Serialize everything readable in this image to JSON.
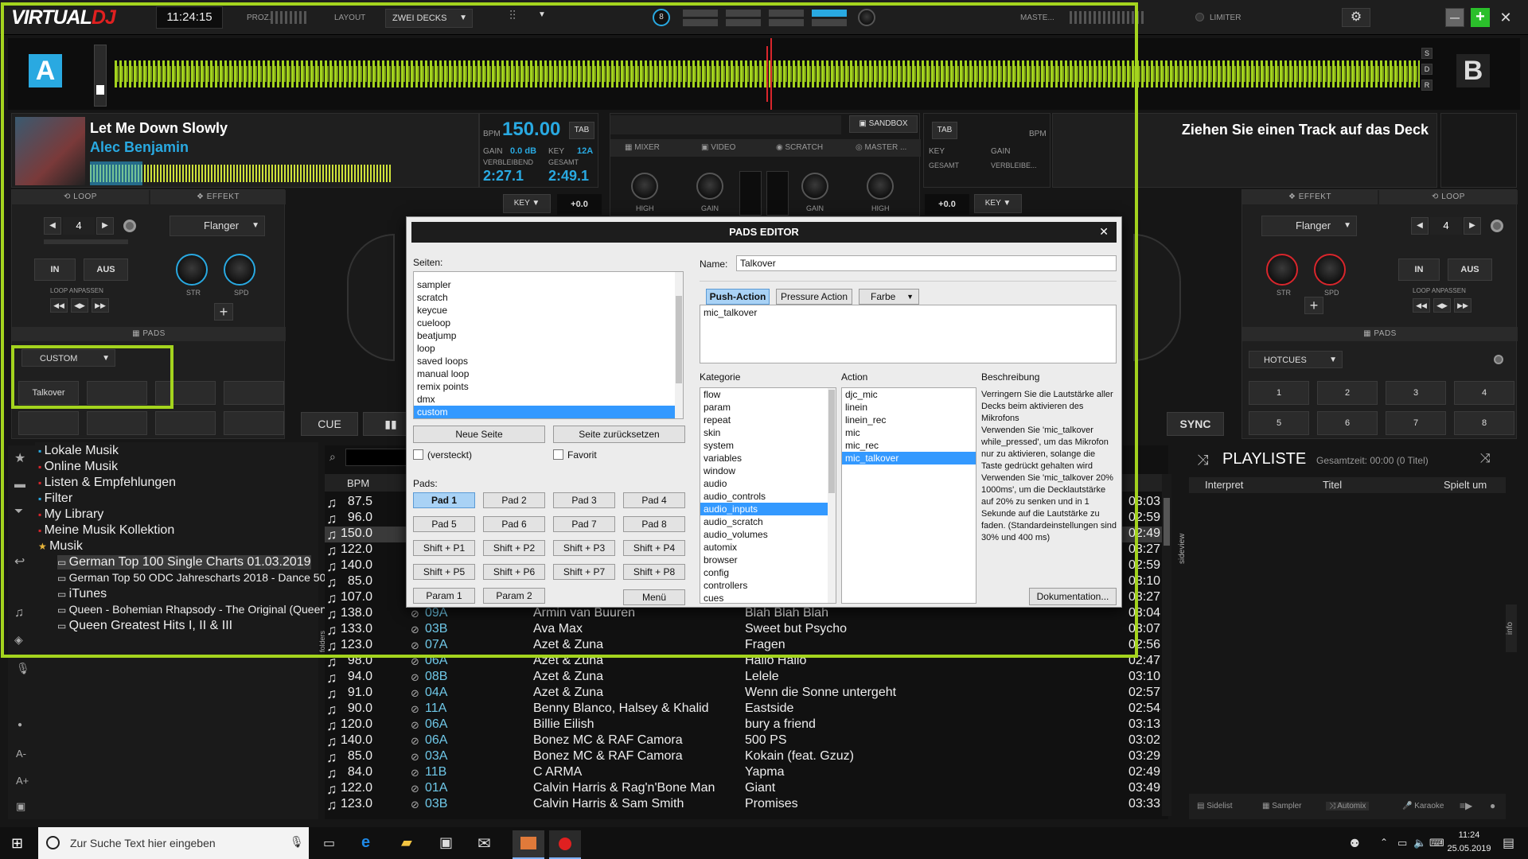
{
  "topbar": {
    "logo_virtual": "VIRTUAL",
    "logo_dj": "DJ",
    "clock": "11:24:15",
    "proz": "PROZ.",
    "layout_label": "LAYOUT",
    "layout_value": "ZWEI DECKS",
    "counter": "8",
    "master_label": "MASTE...",
    "limiter_label": "LIMITER"
  },
  "decks": {
    "a_letter": "A",
    "b_letter": "B",
    "side_s": "S",
    "side_d": "D",
    "side_r": "R"
  },
  "deckA": {
    "title": "Let Me Down Slowly",
    "artist": "Alec Benjamin",
    "bpm_label": "BPM",
    "bpm": "150.00",
    "tab": "TAB",
    "gain_label": "GAIN",
    "gain": "0.0 dB",
    "key_label": "KEY",
    "key": "12A",
    "remain_label": "VERBLEIBEND",
    "remain": "2:27.1",
    "total_label": "GESAMT",
    "total": "2:49.1",
    "key_btn": "KEY",
    "pitch": "+0.0",
    "loop_head": "LOOP",
    "effekt_head": "EFFEKT",
    "loop_val": "4",
    "effect": "Flanger",
    "in": "IN",
    "aus": "AUS",
    "str": "STR",
    "spd": "SPD",
    "loop_anpassen": "LOOP ANPASSEN",
    "pads_head": "PADS",
    "pad_mode": "CUSTOM",
    "pad1": "Talkover",
    "cue": "CUE"
  },
  "deckB": {
    "drop_text": "Ziehen Sie einen Track auf das Deck",
    "tab": "TAB",
    "bpm_label": "BPM",
    "key_label": "KEY",
    "gain_label": "GAIN",
    "total_label": "GESAMT",
    "remain_label": "VERBLEIBE...",
    "key_btn": "KEY",
    "pitch": "+0.0",
    "effekt_head": "EFFEKT",
    "loop_head": "LOOP",
    "effect": "Flanger",
    "loop_val": "4",
    "in": "IN",
    "aus": "AUS",
    "str": "STR",
    "spd": "SPD",
    "loop_anpassen": "LOOP ANPASSEN",
    "pads_head": "PADS",
    "pad_mode": "HOTCUES",
    "sync": "SYNC",
    "pads": [
      "1",
      "2",
      "3",
      "4",
      "5",
      "6",
      "7",
      "8"
    ]
  },
  "mixer": {
    "sandbox": "SANDBOX",
    "tab_mixer": "MIXER",
    "tab_video": "VIDEO",
    "tab_scratch": "SCRATCH",
    "tab_master": "MASTER ...",
    "high": "HIGH",
    "gain": "GAIN"
  },
  "browser": {
    "tree": [
      "Lokale Musik",
      "Online Musik",
      "Listen & Empfehlungen",
      "Filter",
      "My Library",
      "Meine Musik Kollektion",
      "Musik",
      "German Top 100 Single Charts 01.03.2019",
      "German Top 50 ODC Jahrescharts 2018 - Dance 50",
      "iTunes",
      "Queen - Bohemian Rhapsody - The Original (Queen -",
      "Queen Greatest Hits I, II & III"
    ],
    "folders_label": "folders",
    "col_bpm": "BPM",
    "rows": [
      {
        "bpm": "87.5",
        "key": "",
        "artist": "",
        "title": "",
        "time": "03:03"
      },
      {
        "bpm": "96.0",
        "key": "",
        "artist": "",
        "title": "",
        "time": "02:59"
      },
      {
        "bpm": "150.0",
        "key": "",
        "artist": "",
        "title": "",
        "time": "02:49"
      },
      {
        "bpm": "122.0",
        "key": "",
        "artist": "",
        "title": "",
        "time": "03:27"
      },
      {
        "bpm": "140.0",
        "key": "",
        "artist": "",
        "title": "",
        "time": "02:59"
      },
      {
        "bpm": "85.0",
        "key": "",
        "artist": "",
        "title": "",
        "time": "03:10"
      },
      {
        "bpm": "107.0",
        "key": "",
        "artist": "",
        "title": "",
        "time": "03:27"
      },
      {
        "bpm": "138.0",
        "key": "09A",
        "artist": "Armin van Buuren",
        "title": "Blah Blah Blah",
        "time": "03:04"
      },
      {
        "bpm": "133.0",
        "key": "03B",
        "artist": "Ava Max",
        "title": "Sweet but Psycho",
        "time": "03:07"
      },
      {
        "bpm": "123.0",
        "key": "07A",
        "artist": "Azet & Zuna",
        "title": "Fragen",
        "time": "02:56"
      },
      {
        "bpm": "98.0",
        "key": "06A",
        "artist": "Azet & Zuna",
        "title": "Hallo Hallo",
        "time": "02:47"
      },
      {
        "bpm": "94.0",
        "key": "08B",
        "artist": "Azet & Zuna",
        "title": "Lelele",
        "time": "03:10"
      },
      {
        "bpm": "91.0",
        "key": "04A",
        "artist": "Azet & Zuna",
        "title": "Wenn die Sonne untergeht",
        "time": "02:57"
      },
      {
        "bpm": "90.0",
        "key": "11A",
        "artist": "Benny Blanco, Halsey & Khalid",
        "title": "Eastside",
        "time": "02:54"
      },
      {
        "bpm": "120.0",
        "key": "06A",
        "artist": "Billie Eilish",
        "title": "bury a friend",
        "time": "03:13"
      },
      {
        "bpm": "140.0",
        "key": "06A",
        "artist": "Bonez MC & RAF Camora",
        "title": "500 PS",
        "time": "03:02"
      },
      {
        "bpm": "85.0",
        "key": "03A",
        "artist": "Bonez MC & RAF Camora",
        "title": "Kokain (feat. Gzuz)",
        "time": "03:29"
      },
      {
        "bpm": "84.0",
        "key": "11B",
        "artist": "C ARMA",
        "title": "Yapma",
        "time": "02:49"
      },
      {
        "bpm": "122.0",
        "key": "01A",
        "artist": "Calvin Harris & Rag'n'Bone Man",
        "title": "Giant",
        "time": "03:49"
      },
      {
        "bpm": "123.0",
        "key": "03B",
        "artist": "Calvin Harris & Sam Smith",
        "title": "Promises",
        "time": "03:33"
      }
    ]
  },
  "playlist": {
    "title": "PLAYLISTE",
    "total": "Gesamtzeit: 00:00 (0 Titel)",
    "col_interpret": "Interpret",
    "col_titel": "Titel",
    "col_spielt": "Spielt um",
    "sideview": "sideview",
    "info": "info",
    "tabs": [
      "Sidelist",
      "Sampler",
      "Automix",
      "Karaoke"
    ]
  },
  "modal": {
    "title": "PADS EDITOR",
    "seiten_label": "Seiten:",
    "seiten": [
      "sampler",
      "scratch",
      "keycue",
      "cueloop",
      "beatjump",
      "loop",
      "saved loops",
      "manual loop",
      "remix points",
      "dmx",
      "custom"
    ],
    "neue_seite": "Neue Seite",
    "seite_reset": "Seite zurücksetzen",
    "versteckt": "(versteckt)",
    "favorit": "Favorit",
    "pads_label": "Pads:",
    "pads": [
      "Pad 1",
      "Pad 2",
      "Pad 3",
      "Pad 4",
      "Pad 5",
      "Pad 6",
      "Pad 7",
      "Pad 8",
      "Shift + P1",
      "Shift + P2",
      "Shift + P3",
      "Shift + P4",
      "Shift + P5",
      "Shift + P6",
      "Shift + P7",
      "Shift + P8",
      "Param 1",
      "Param 2"
    ],
    "menu": "Menü",
    "name_label": "Name:",
    "name_value": "Talkover",
    "push_action": "Push-Action",
    "pressure_action": "Pressure Action",
    "farbe": "Farbe",
    "action_text": "mic_talkover",
    "kategorie_label": "Kategorie",
    "action_label": "Action",
    "beschreibung_label": "Beschreibung",
    "kategorien": [
      "flow",
      "param",
      "repeat",
      "skin",
      "system",
      "variables",
      "window",
      "audio",
      "audio_controls",
      "audio_inputs",
      "audio_scratch",
      "audio_volumes",
      "automix",
      "browser",
      "config",
      "controllers",
      "cues"
    ],
    "actions": [
      "djc_mic",
      "linein",
      "linein_rec",
      "mic",
      "mic_rec",
      "mic_talkover"
    ],
    "beschreibung": "Verringern Sie die Lautstärke aller Decks beim aktivieren des Mikrofons\nVerwenden Sie 'mic_talkover while_pressed', um das Mikrofon nur zu aktivieren, solange die Taste gedrückt gehalten wird\nVerwenden Sie 'mic_talkover 20% 1000ms', um die Decklautstärke auf 20% zu senken und in 1 Sekunde auf die Lautstärke zu faden. (Standardeinstellungen sind 30% und 400 ms)",
    "doku": "Dokumentation..."
  },
  "taskbar": {
    "search_placeholder": "Zur Suche Text hier eingeben",
    "time": "11:24",
    "date": "25.05.2019"
  },
  "colors": {
    "accent": "#29a9e1",
    "wave": "#a4d41e",
    "highlight": "#a4d41e",
    "knob_red": "#d9262c"
  }
}
